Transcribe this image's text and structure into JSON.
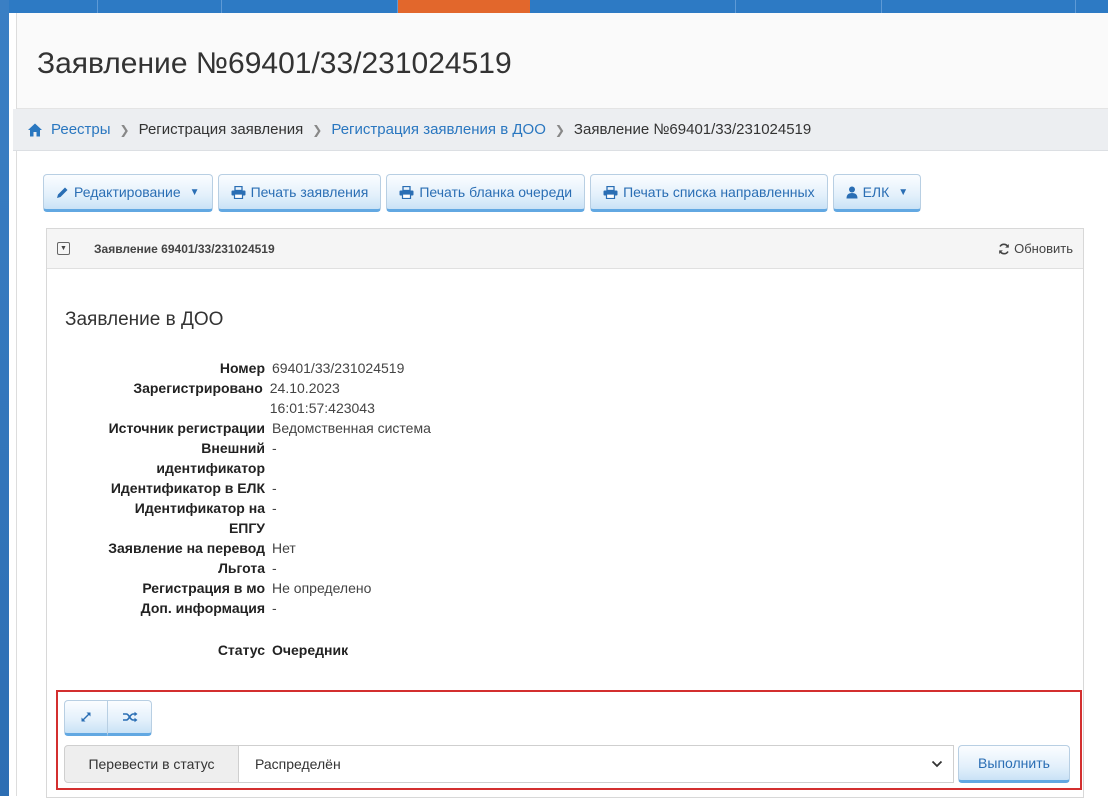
{
  "page": {
    "title": "Заявление №69401/33/231024519"
  },
  "breadcrumb": {
    "items": [
      {
        "label": "Реестры"
      },
      {
        "label": "Регистрация заявления"
      },
      {
        "label": "Регистрация заявления в ДОО"
      },
      {
        "label": "Заявление №69401/33/231024519"
      }
    ]
  },
  "toolbar": {
    "edit": "Редактирование",
    "print_application": "Печать заявления",
    "print_queue_form": "Печать бланка очереди",
    "print_directed_list": "Печать списка направленных",
    "elk": "ЕЛК"
  },
  "panel": {
    "header": "Заявление 69401/33/231024519",
    "refresh": "Обновить",
    "section_title": "Заявление в ДОО"
  },
  "details": [
    {
      "label": "Номер",
      "value": "69401/33/231024519"
    },
    {
      "label": "Зарегистрировано",
      "value": "24.10.2023 16:01:57:423043"
    },
    {
      "label": "Источник регистрации",
      "value": "Ведомственная система"
    },
    {
      "label": "Внешний",
      "value": "-"
    },
    {
      "label": "идентификатор",
      "value": ""
    },
    {
      "label": "Идентификатор в ЕЛК",
      "value": "-"
    },
    {
      "label": "Идентификатор на",
      "value": "-"
    },
    {
      "label": "ЕПГУ",
      "value": ""
    },
    {
      "label": "Заявление на перевод",
      "value": "Нет"
    },
    {
      "label": "Льгота",
      "value": "-"
    },
    {
      "label": "Регистрация в мо",
      "value": "Не определено"
    },
    {
      "label": "Доп. информация",
      "value": "-"
    }
  ],
  "status": {
    "label": "Статус",
    "value": "Очередник"
  },
  "action": {
    "addon_label": "Перевести в статус",
    "selected_status": "Распределён",
    "run_label": "Выполнить"
  },
  "icons": {
    "home": "home-icon",
    "pencil": "pencil-icon",
    "print": "print-icon",
    "user": "user-icon",
    "refresh": "refresh-icon",
    "expand": "expand-icon",
    "shuffle": "shuffle-icon",
    "collapse": "collapse-icon",
    "chevron": "chevron-down-icon"
  },
  "colors": {
    "link": "#2a77c0",
    "button_text": "#2a6eb4",
    "highlight_border": "#d32f2f",
    "top_bar": "#2d7ac4",
    "active_tab": "#e2672c"
  }
}
